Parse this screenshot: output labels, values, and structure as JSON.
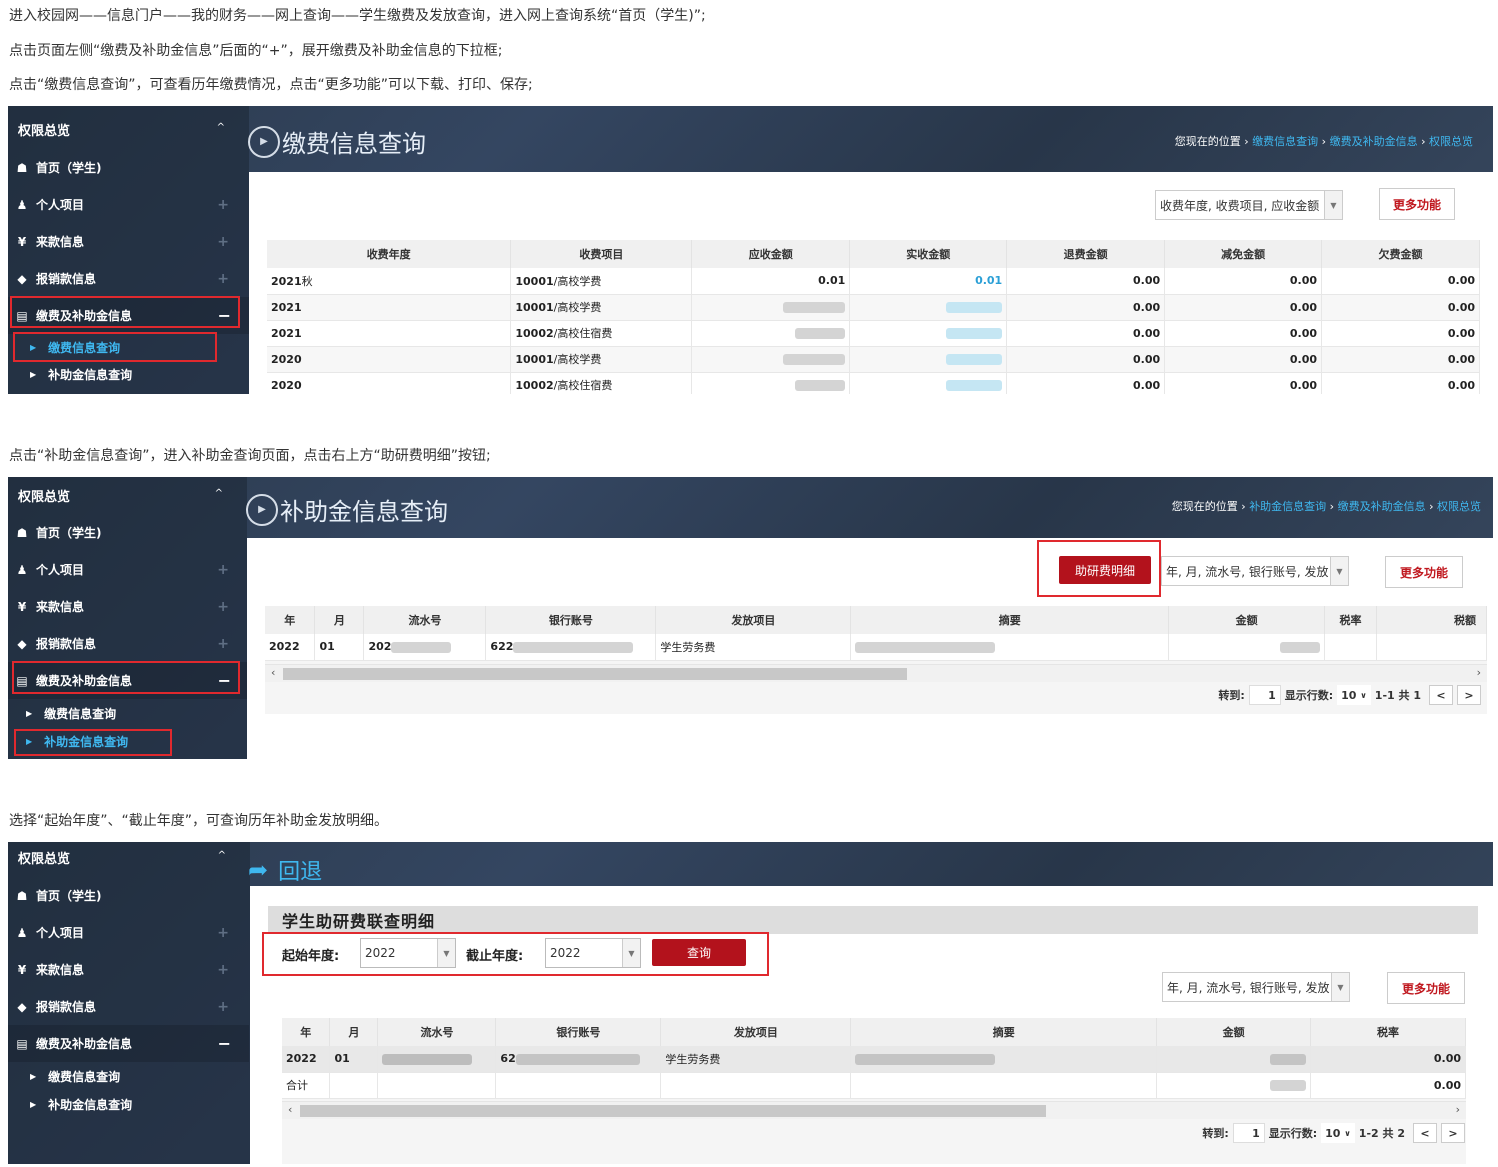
{
  "instructions": {
    "step1": "进入校园网——信息门户——我的财务——网上查询——学生缴费及发放查询，进入网上查询系统“首页（学生)”;",
    "step2": "点击页面左侧“缴费及补助金信息”后面的“+”，展开缴费及补助金信息的下拉框;",
    "step3": "点击“缴费信息查询”，可查看历年缴费情况，点击“更多功能”可以下载、打印、保存;",
    "step4": "点击“补助金信息查询”，进入补助金查询页面，点击右上方“助研费明细”按钮;",
    "step5": "选择“起始年度”、“截止年度”，可查询历年补助金发放明细。"
  },
  "sidebar": {
    "header": "权限总览",
    "home": "首页（学生)",
    "personal": "个人项目",
    "income": "来款信息",
    "reimburse": "报销款信息",
    "fees": "缴费及补助金信息",
    "sub_fee_query": "缴费信息查询",
    "sub_subsidy_query": "补助金信息查询"
  },
  "panel1": {
    "title": "缴费信息查询",
    "crumb_prefix": "您现在的位置",
    "crumb_1": "缴费信息查询",
    "crumb_2": "缴费及补助金信息",
    "crumb_3": "权限总览",
    "column_select": "收费年度, 收费项目, 应收金额",
    "more_button": "更多功能",
    "columns": [
      "收费年度",
      "收费项目",
      "应收金额",
      "实收金额",
      "退费金额",
      "减免金额",
      "欠费金额"
    ],
    "rows": [
      {
        "year": "2021",
        "year_suffix": "秋",
        "code": "10001",
        "item": "/高校学费",
        "due": "0.01",
        "paid": "0.01",
        "refund": "0.00",
        "waive": "0.00",
        "owed": "0.00"
      },
      {
        "year": "2021",
        "year_suffix": "",
        "code": "10001",
        "item": "/高校学费",
        "due": "",
        "paid": "",
        "refund": "0.00",
        "waive": "0.00",
        "owed": "0.00"
      },
      {
        "year": "2021",
        "year_suffix": "",
        "code": "10002",
        "item": "/高校住宿费",
        "due": "",
        "paid": "",
        "refund": "0.00",
        "waive": "0.00",
        "owed": "0.00"
      },
      {
        "year": "2020",
        "year_suffix": "",
        "code": "10001",
        "item": "/高校学费",
        "due": "",
        "paid": "",
        "refund": "0.00",
        "waive": "0.00",
        "owed": "0.00"
      },
      {
        "year": "2020",
        "year_suffix": "",
        "code": "10002",
        "item": "/高校住宿费",
        "due": "",
        "paid": "",
        "refund": "0.00",
        "waive": "0.00",
        "owed": "0.00"
      }
    ]
  },
  "panel2": {
    "title": "补助金信息查询",
    "crumb_prefix": "您现在的位置",
    "crumb_1": "补助金信息查询",
    "crumb_2": "缴费及补助金信息",
    "crumb_3": "权限总览",
    "detail_button": "助研费明细",
    "column_select": "年, 月, 流水号, 银行账号, 发放",
    "more_button": "更多功能",
    "columns": [
      "年",
      "月",
      "流水号",
      "银行账号",
      "发放项目",
      "摘要",
      "金额",
      "税率",
      "税额"
    ],
    "row": {
      "year": "2022",
      "month": "01",
      "serial": "202",
      "account": "622",
      "item": "学生劳务费"
    },
    "pager": {
      "goto_label": "转到:",
      "goto_value": "1",
      "rows_label": "显示行数:",
      "rows_value": "10",
      "range": "1-1",
      "total": "共 1",
      "prev": "<",
      "next": ">"
    }
  },
  "panel3": {
    "back_label": "回退",
    "section_title": "学生助研费联查明细",
    "start_label": "起始年度:",
    "start_value": "2022",
    "end_label": "截止年度:",
    "end_value": "2022",
    "query_button": "查询",
    "column_select": "年, 月, 流水号, 银行账号, 发放",
    "more_button": "更多功能",
    "columns": [
      "年",
      "月",
      "流水号",
      "银行账号",
      "发放项目",
      "摘要",
      "金额",
      "税率"
    ],
    "row": {
      "year": "2022",
      "month": "01",
      "account": "62",
      "item": "学生劳务费",
      "tax_rate": "0.00"
    },
    "total_row": {
      "label": "合计",
      "tax_rate": "0.00"
    },
    "pager": {
      "goto_label": "转到:",
      "goto_value": "1",
      "rows_label": "显示行数:",
      "rows_value": "10",
      "range": "1-2",
      "total": "共 2",
      "prev": "<",
      "next": ">"
    }
  },
  "colors": {
    "accent_red": "#b3121c",
    "link_blue": "#3fb8f0",
    "highlight_box": "#e0292e"
  }
}
